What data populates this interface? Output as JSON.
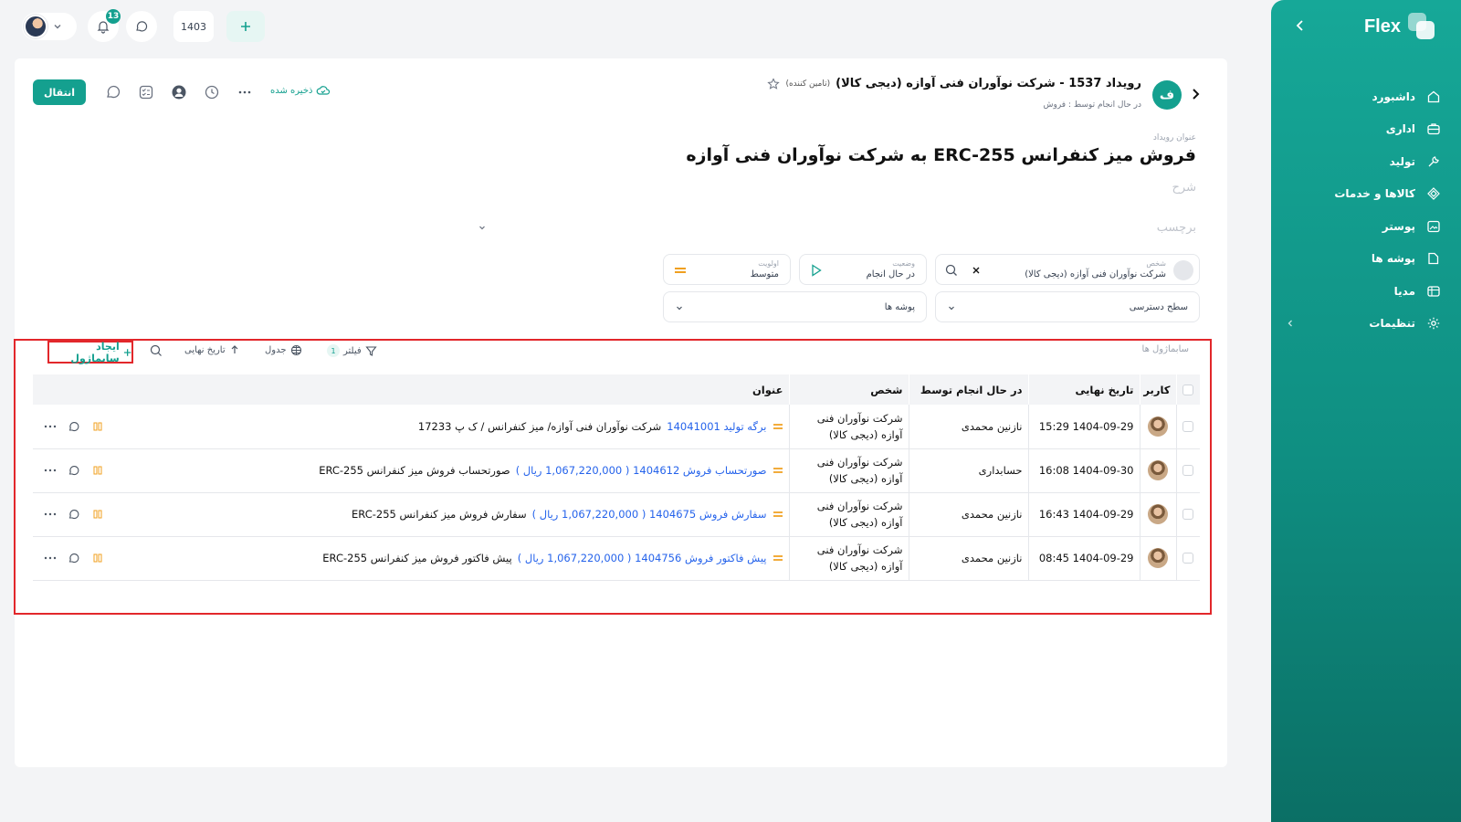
{
  "topbar": {
    "notifications_count": "13",
    "year": "1403"
  },
  "sidebar": {
    "logo": "Flex",
    "items": [
      {
        "label": "داشبورد"
      },
      {
        "label": "اداری"
      },
      {
        "label": "تولید"
      },
      {
        "label": "کالاها و خدمات"
      },
      {
        "label": "پوستر"
      },
      {
        "label": "پوشه ها"
      },
      {
        "label": "مدیا"
      },
      {
        "label": "تنظیمات"
      }
    ]
  },
  "event": {
    "avatar_letter": "ف",
    "title": "رویداد 1537 - شرکت نوآوران فنی آوازه (دیجی کالا)",
    "title_tag": "(تامین کننده)",
    "subtitle": "در حال انجام توسط : فروش",
    "transfer_label": "انتقال",
    "saved_label": "ذخیره شده",
    "name_field_label": "عنوان رویداد",
    "name": "فروش میز کنفرانس ERC-255 به  شرکت نوآوران فنی آوازه",
    "description_placeholder": "شرح",
    "tag_placeholder": "برچسب"
  },
  "fields": {
    "person_label": "شخص",
    "person_value": "شرکت نوآوران فنی آوازه (دیجی کالا)",
    "status_label": "وضعیت",
    "status_value": "در حال انجام",
    "priority_label": "اولویت",
    "priority_value": "متوسط",
    "access_label": "سطح دسترسی",
    "folders_label": "پوشه ها"
  },
  "subtasks": {
    "section_title": "سابماژول ها",
    "create_label": "ایجاد سابماژول",
    "sort_label": "تاریخ نهایی",
    "view_label": "جدول",
    "filter_label": "فیلتر",
    "filter_count": "1",
    "columns": [
      "کاربر",
      "تاریخ نهایی",
      "در حال انجام توسط",
      "شخص",
      "عنوان"
    ],
    "rows": [
      {
        "due": "1404-09-29 15:29",
        "assignee": "نازنین محمدی",
        "person": "شرکت نوآوران فنی آوازه (دیجی کالا)",
        "link": "برگه تولید 14041001",
        "title": "شرکت نوآوران فنی آوازه/ میز کنفرانس / ک پ 17233"
      },
      {
        "due": "1404-09-30 16:08",
        "assignee": "حسابداری",
        "person": "شرکت نوآوران فنی آوازه (دیجی کالا)",
        "link": "صورتحساب فروش 1404612  ( 1,067,220,000 ریال )",
        "title": "صورتحساب فروش میز کنفرانس ERC-255"
      },
      {
        "due": "1404-09-29 16:43",
        "assignee": "نازنین محمدی",
        "person": "شرکت نوآوران فنی آوازه (دیجی کالا)",
        "link": "سفارش فروش 1404675  ( 1,067,220,000 ریال )",
        "title": "سفارش فروش میز کنفرانس ERC-255"
      },
      {
        "due": "1404-09-29 08:45",
        "assignee": "نازنین محمدی",
        "person": "شرکت نوآوران فنی آوازه (دیجی کالا)",
        "link": "پیش فاکتور فروش 1404756  ( 1,067,220,000 ریال )",
        "title": "پیش فاکتور فروش میز کنفرانس ERC-255"
      }
    ]
  },
  "colors": {
    "accent": "#14a08f",
    "highlight_border": "#e2272b",
    "link": "#2563eb",
    "progress": "#f0a020"
  }
}
